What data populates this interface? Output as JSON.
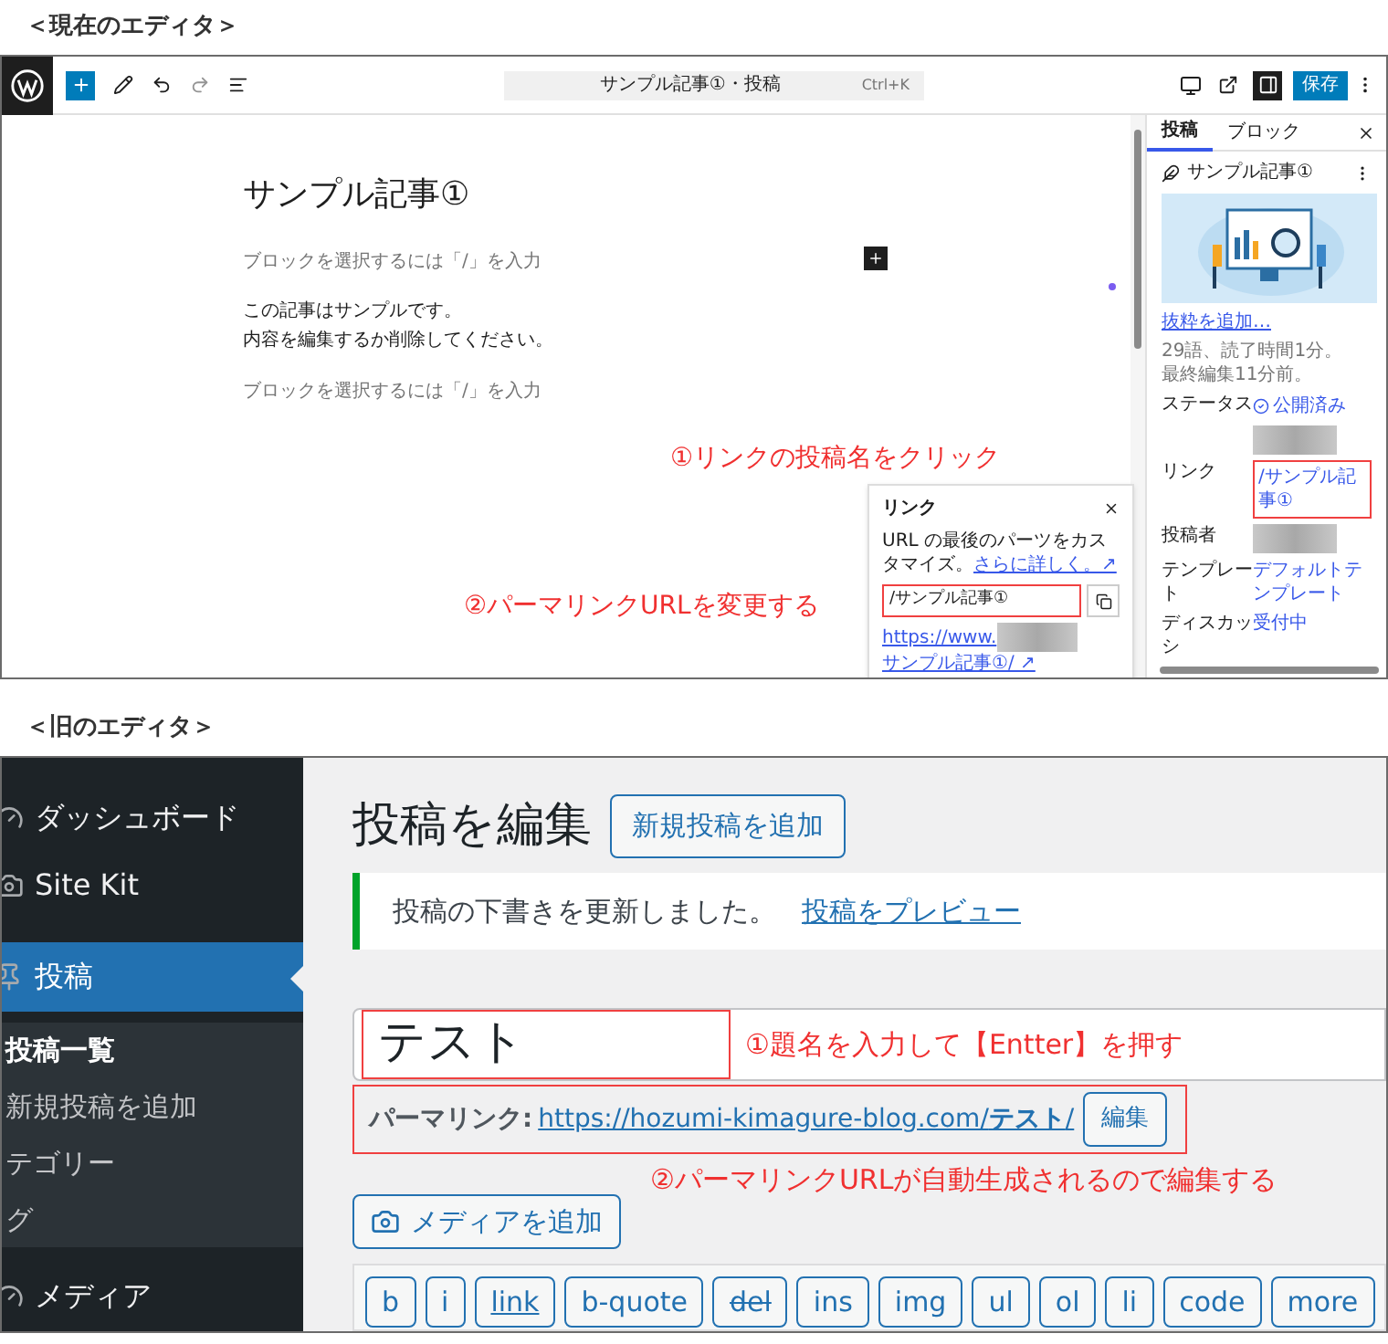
{
  "sections": [
    {
      "label": "＜現在のエディタ＞"
    },
    {
      "label": "＜旧のエディタ＞"
    }
  ],
  "block_editor": {
    "toolbar": {
      "command_bar": "サンプル記事①・投稿",
      "shortcut": "Ctrl+K",
      "save_button": "保存",
      "sidebar_toggle_on": true
    },
    "canvas": {
      "title": "サンプル記事①",
      "placeholder_1": "ブロックを選択するには「/」を入力",
      "paragraph_lines": [
        "この記事はサンプルです。",
        "内容を編集するか削除してください。"
      ],
      "placeholder_2": "ブロックを選択するには「/」を入力"
    },
    "sidebar": {
      "tabs": [
        {
          "label": "投稿",
          "selected": true
        },
        {
          "label": "ブロック",
          "selected": false
        }
      ],
      "post_title": "サンプル記事①",
      "excerpt_link": "抜粋を追加…",
      "stats": [
        "29語、読了時間1分。",
        "最終編集11分前。"
      ],
      "rows": [
        {
          "label": "ステータス",
          "value": "公開済み",
          "kind": "status"
        },
        {
          "kind": "blurred"
        },
        {
          "label": "リンク",
          "value": "/サンプル記事①",
          "kind": "link"
        },
        {
          "label": "投稿者",
          "kind": "blurred"
        },
        {
          "label": "テンプレート",
          "value": "デフォルトテンプレート",
          "kind": "link"
        },
        {
          "label": "ディスカッシ",
          "value": "受付中",
          "kind": "link"
        }
      ]
    },
    "popover": {
      "title": "リンク",
      "description": "URL の最後のパーツをカスタマイズ。",
      "learn_more": "さらに詳しく。↗",
      "slug": "/サンプル記事①",
      "url_prefix": "https://www.",
      "url_suffix": "サンプル記事①/ ↗"
    },
    "annotations": [
      "①リンクの投稿名をクリック",
      "②パーマリンクURLを変更する"
    ]
  },
  "classic_editor": {
    "menu": [
      {
        "label": "ダッシュボード",
        "kind": "top",
        "selected": false
      },
      {
        "label": "Site Kit",
        "kind": "top",
        "selected": false
      },
      {
        "label": "投稿",
        "kind": "top",
        "selected": true
      },
      {
        "label": "投稿一覧",
        "kind": "sub",
        "selected": true
      },
      {
        "label": "新規投稿を追加",
        "kind": "sub",
        "selected": false
      },
      {
        "label": "テゴリー",
        "kind": "sub",
        "selected": false
      },
      {
        "label": "グ",
        "kind": "sub",
        "selected": false
      },
      {
        "label": "メディア",
        "kind": "top",
        "selected": false
      }
    ],
    "heading": "投稿を編集",
    "add_new_button": "新規投稿を追加",
    "notice": {
      "message": "投稿の下書きを更新しました。",
      "link": "投稿をプレビュー"
    },
    "title_value": "テスト",
    "permalink": {
      "label": "パーマリンク:",
      "url": "https://hozumi-kimagure-blog.com/",
      "slug": "テスト",
      "trailing": "/",
      "edit_button": "編集"
    },
    "media_button": "メディアを追加",
    "quicktags": [
      "b",
      "i",
      "link",
      "b-quote",
      "del",
      "ins",
      "img",
      "ul",
      "ol",
      "li",
      "code",
      "more"
    ],
    "annotations": [
      "①題名を入力して【Entter】を押す",
      "②パーマリンクURLが自動生成されるので編集する"
    ]
  }
}
